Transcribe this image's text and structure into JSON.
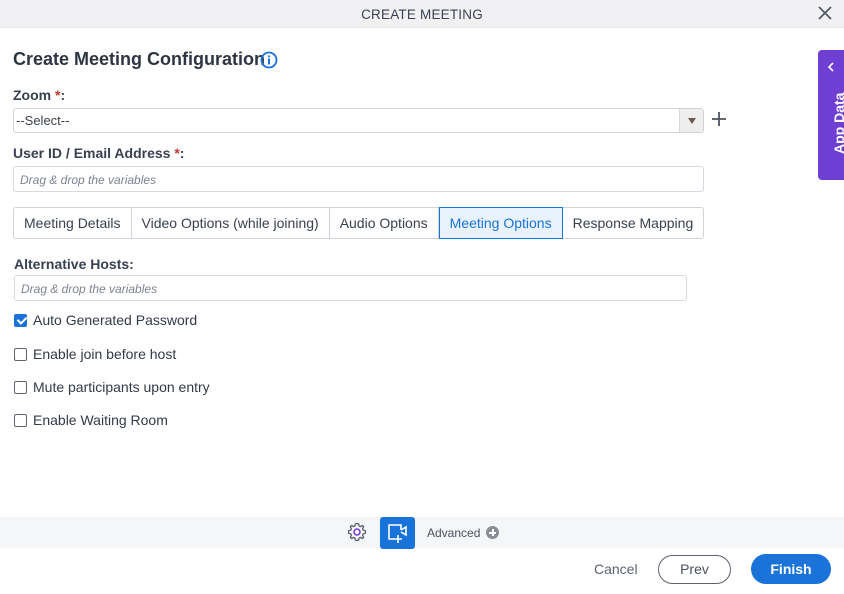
{
  "window": {
    "title": "CREATE MEETING",
    "close_icon": "close-icon"
  },
  "heading": {
    "title": "Create Meeting Configuration",
    "info_icon": "info-icon"
  },
  "form": {
    "zoom": {
      "label": "Zoom",
      "required_mark": "*",
      "suffix": ":",
      "selected": "--Select--",
      "add_icon": "plus-icon"
    },
    "user_id": {
      "label": "User ID / Email Address",
      "required_mark": "*",
      "suffix": ":",
      "placeholder": "Drag & drop the variables"
    }
  },
  "tabs": [
    {
      "label": "Meeting Details",
      "active": false
    },
    {
      "label": "Video Options (while joining)",
      "active": false
    },
    {
      "label": "Audio Options",
      "active": false
    },
    {
      "label": "Meeting Options",
      "active": true
    },
    {
      "label": "Response Mapping",
      "active": false
    }
  ],
  "meeting_options": {
    "alternative_hosts": {
      "label": "Alternative Hosts:",
      "placeholder": "Drag & drop the variables"
    },
    "checkboxes": [
      {
        "label": "Auto Generated Password",
        "checked": true
      },
      {
        "label": "Enable join before host",
        "checked": false
      },
      {
        "label": "Mute participants upon entry",
        "checked": false
      },
      {
        "label": "Enable Waiting Room",
        "checked": false
      }
    ]
  },
  "side_panel": {
    "label": "App Data",
    "icon": "chevron-left-icon"
  },
  "toolbar": {
    "settings_icon": "gear-icon",
    "video_icon": "video-add-icon",
    "advanced_label": "Advanced",
    "advanced_icon": "plus-circle-icon"
  },
  "footer": {
    "cancel_label": "Cancel",
    "prev_label": "Prev",
    "finish_label": "Finish"
  },
  "colors": {
    "accent": "#1a73d9",
    "side_panel": "#6f3fd4",
    "required": "#c0392b"
  }
}
